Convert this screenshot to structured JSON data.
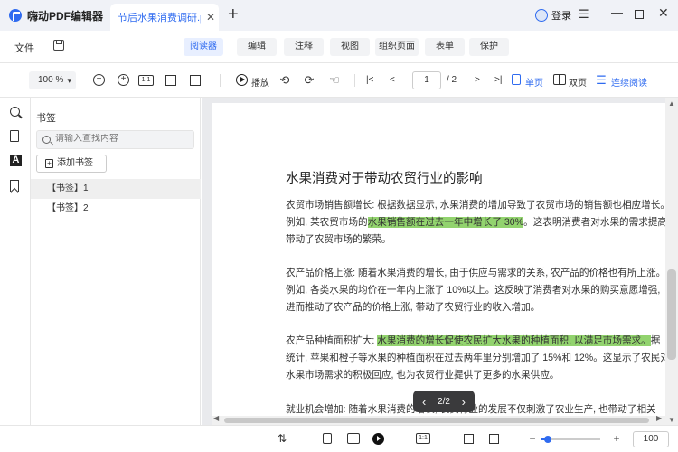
{
  "app": {
    "name": "嗨动PDF编辑器",
    "doc_tab": "节后水果消费调研.p...",
    "tab_close": "✕",
    "new_tab": "+",
    "login": "登录",
    "window": {
      "menu": "☰",
      "minimize": "—",
      "close": "✕"
    }
  },
  "menubar": {
    "file": "文件",
    "tabs": [
      {
        "label": "阅读器",
        "active": true
      },
      {
        "label": "编辑"
      },
      {
        "label": "注释"
      },
      {
        "label": "视图"
      },
      {
        "label": "组织页面"
      },
      {
        "label": "表单"
      },
      {
        "label": "保护"
      }
    ]
  },
  "toolbar": {
    "zoom": "100 %",
    "zoom_arrow": "▾",
    "zoom_out": "−",
    "zoom_in": "+",
    "actual_size": "1:1",
    "play_label": "播放",
    "first_page": "|<",
    "prev_page": "<",
    "current_page": "1",
    "total_pages": "/ 2",
    "next_page": ">",
    "last_page": ">|",
    "single_page": "单页",
    "double_page": "双页",
    "continuous": "连续阅读"
  },
  "sidebar": {
    "icons": [
      "search-icon",
      "page-icon",
      "font-icon",
      "bookmark-icon"
    ],
    "font_glyph": "A"
  },
  "bookmarks": {
    "title": "书签",
    "search_placeholder": "请输入查找内容",
    "add_label": "添加书签",
    "items": [
      {
        "label": "【书签】1",
        "selected": true
      },
      {
        "label": "【书签】2",
        "selected": false
      }
    ]
  },
  "document": {
    "title": "水果消费对于带动农贸行业的影响",
    "p1": {
      "l1": "农贸市场销售额增长: 根据数据显示, 水果消费的增加导致了农贸市场的销售额也相应增长。",
      "l2a": "例如, 某农贸市场的",
      "l2hl": "水果销售额在过去一年中增长了 30%",
      "l2b": "。这表明消费者对水果的需求提高,",
      "l3": "带动了农贸市场的繁荣。"
    },
    "p2": {
      "l1": "农产品价格上涨: 随着水果消费的增长, 由于供应与需求的关系, 农产品的价格也有所上涨。",
      "l2": "例如, 各类水果的均价在一年内上涨了 10%以上。这反映了消费者对水果的购买意愿增强,",
      "l3": "进而推动了农产品的价格上涨, 带动了农贸行业的收入增加。"
    },
    "p3": {
      "l1a": "农产品种植面积扩大: ",
      "l1hl": "水果消费的增长促使农民扩大水果的种植面积, 以满足市场需求。",
      "l1b": "据",
      "l2": "统计, 苹果和橙子等水果的种植面积在过去两年里分别增加了 15%和 12%。这显示了农民对",
      "l3": "水果市场需求的积极回应, 也为农贸行业提供了更多的水果供应。"
    },
    "p4": {
      "l1": "就业机会增加: 随着水果消费的增长, 农贸行业的发展不仅刺激了农业生产, 也带动了相关"
    },
    "page_indicator": "2/2"
  },
  "statusbar": {
    "actual_size": "1:1",
    "zoom_minus": "−",
    "zoom_plus": "+",
    "zoom_value": "100",
    "zoom_slider_fraction": 0.12
  },
  "colors": {
    "accent": "#2f6bf0",
    "highlight": "#92d36e"
  }
}
